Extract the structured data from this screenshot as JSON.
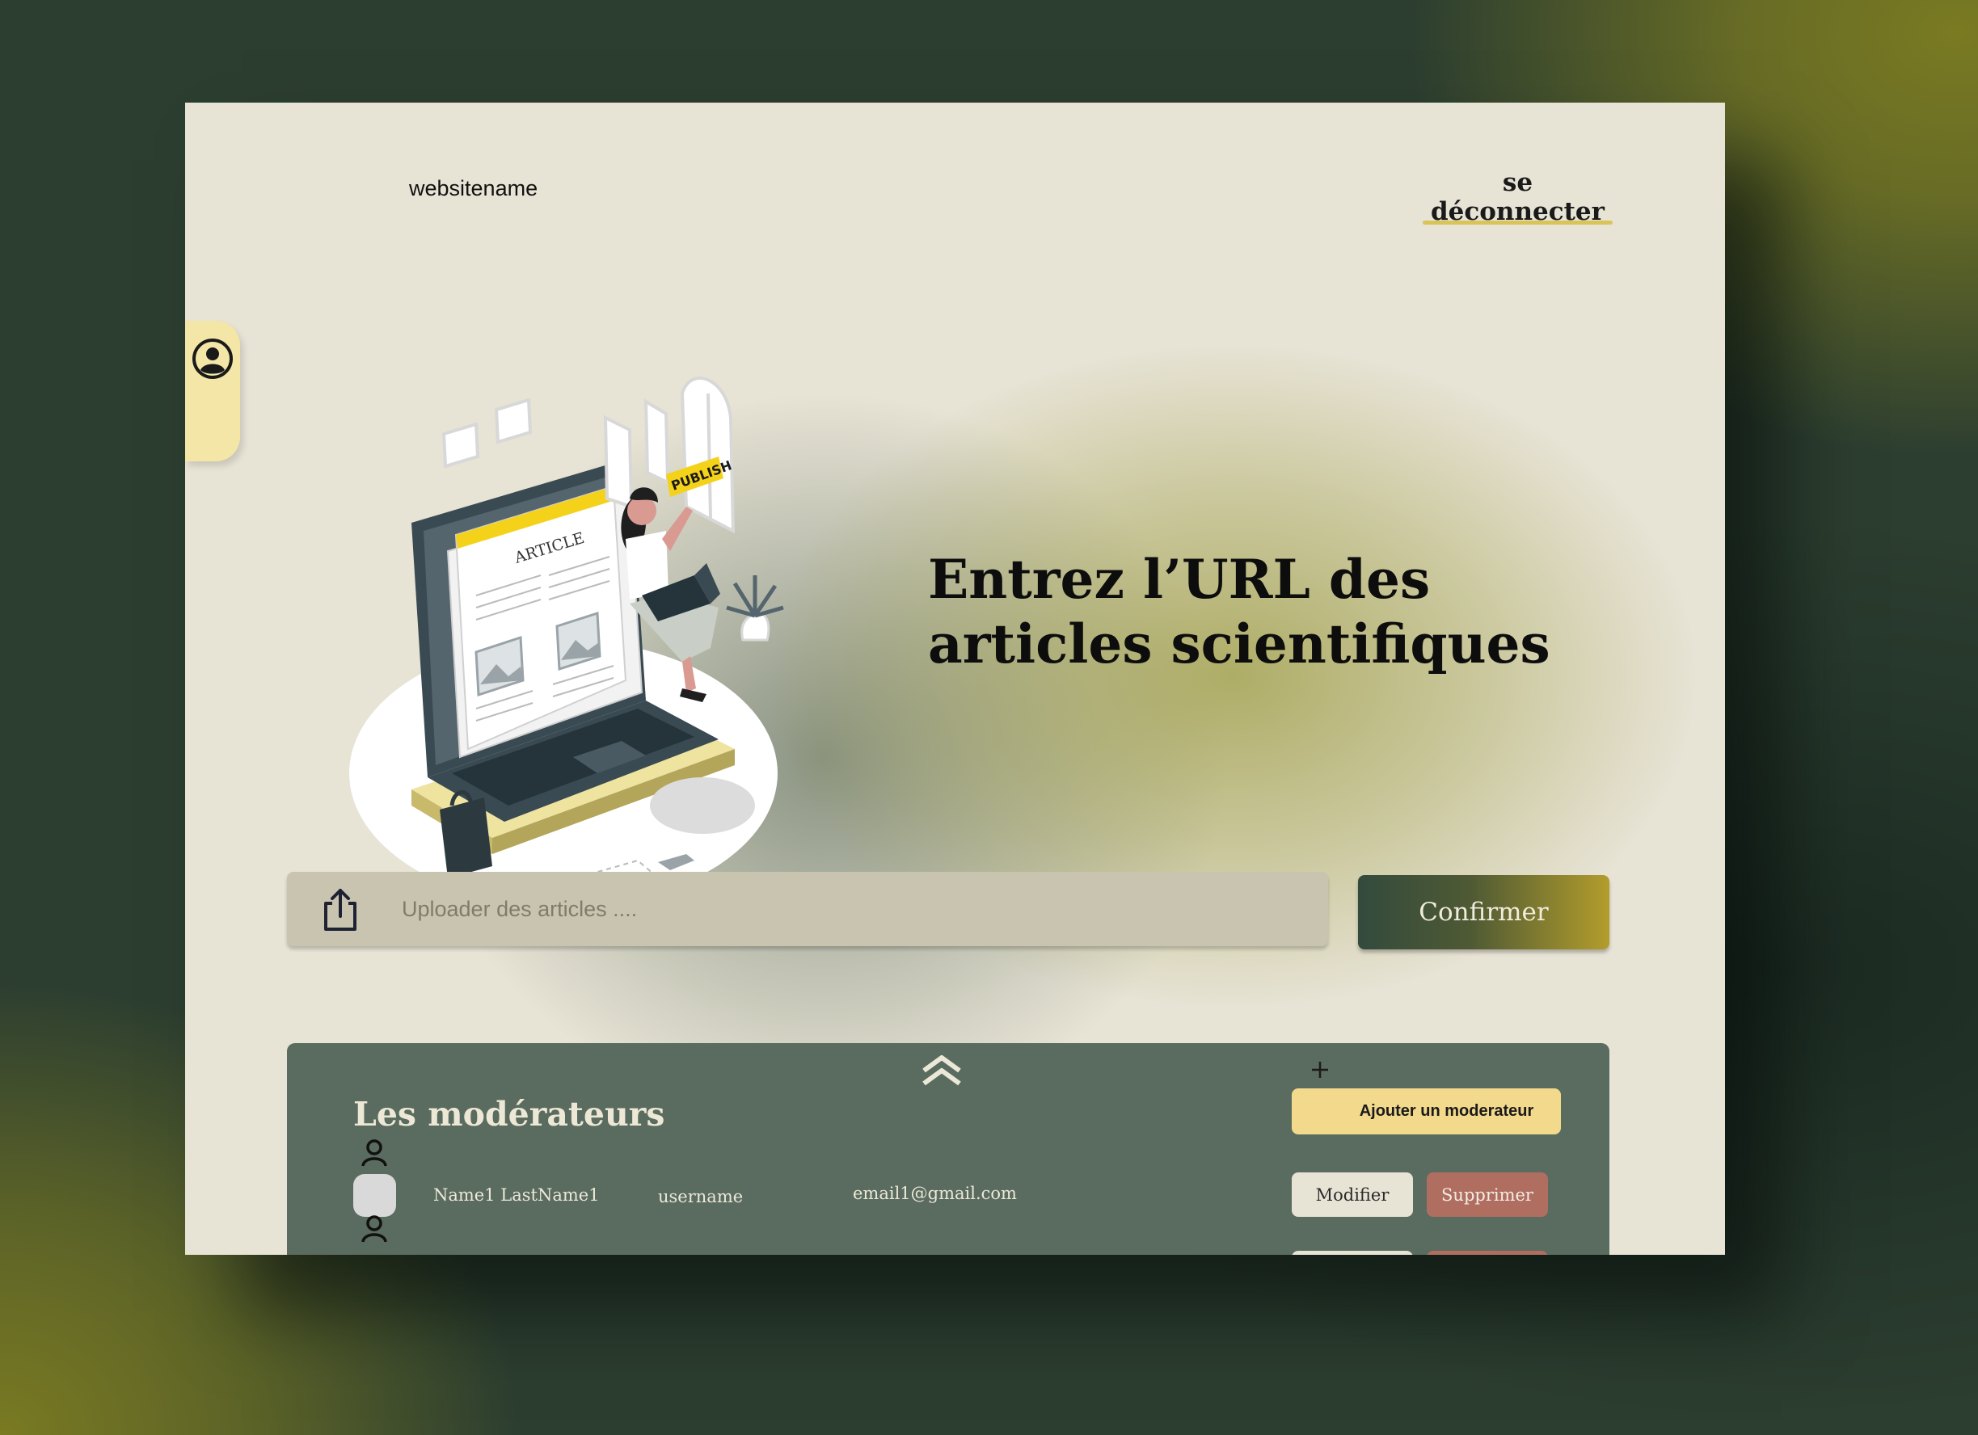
{
  "header": {
    "brand": "websitename",
    "logout_label": "se déconnecter"
  },
  "hero": {
    "headline_line1": "Entrez l’URL des",
    "headline_line2": "articles scientifiques",
    "illustration_article_label": "ARTICLE",
    "illustration_publish_label": "PUBLISH"
  },
  "upload": {
    "placeholder": "Uploader des articles ....",
    "confirm_label": "Confirmer"
  },
  "moderators": {
    "title": "Les modérateurs",
    "add_label": "Ajouter un moderateur",
    "rows": [
      {
        "name": "Name1 LastName1",
        "username": "username",
        "email": "email1@gmail.com",
        "edit_label": "Modifier",
        "delete_label": "Supprimer"
      }
    ]
  },
  "colors": {
    "page_background": "#e7e3d5",
    "accent_yellow": "#d9c557",
    "panel_green": "#5a6b5f",
    "add_button": "#f3d98c",
    "delete_button": "#b06e60",
    "confirm_gradient_start": "#334a3d",
    "confirm_gradient_end": "#b39d2c"
  },
  "icons": {
    "user_tab": "user-circle-icon",
    "upload": "upload-share-icon",
    "collapse": "chevrons-up-icon",
    "add": "plus-icon",
    "person": "person-icon"
  }
}
